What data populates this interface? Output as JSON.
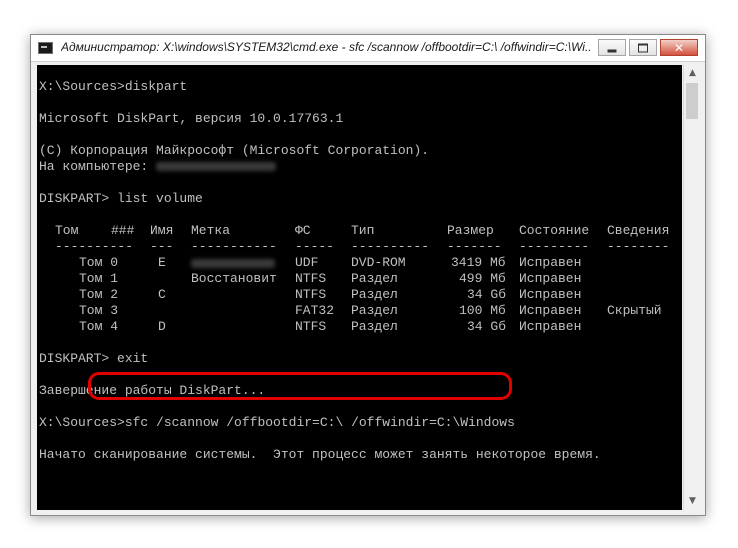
{
  "window": {
    "title": "Администратор: X:\\windows\\SYSTEM32\\cmd.exe - sfc  /scannow /offbootdir=C:\\ /offwindir=C:\\Wi..."
  },
  "console": {
    "lines": {
      "l1": "X:\\Sources>diskpart",
      "l2": "Microsoft DiskPart, версия 10.0.17763.1",
      "l3": "(C) Корпорация Майкрософт (Microsoft Corporation).",
      "l4": "На компьютере: ",
      "l5": "DISKPART> list volume",
      "l6": "DISKPART> exit",
      "l7": "Завершение работы DiskPart...",
      "l8_prompt": "X:\\Sources>",
      "l8_cmd": "sfc /scannow /offbootdir=C:\\ /offwindir=C:\\Windows",
      "l9": "Начато сканирование системы.  Этот процесс может занять некоторое время."
    },
    "table": {
      "headers": [
        "Том",
        "###",
        "Имя",
        "Метка",
        "ФС",
        "Тип",
        "Размер",
        "Состояние",
        "Сведения"
      ],
      "separators": [
        "----------",
        "---",
        "-----------",
        "-----",
        "----------",
        "-------",
        "---------",
        "--------"
      ],
      "rows": [
        {
          "num": "Том 0",
          "letter": "E",
          "label": "",
          "fs": "UDF",
          "type": "DVD-ROM",
          "size": "3419 Мб",
          "state": "Исправен",
          "info": ""
        },
        {
          "num": "Том 1",
          "letter": "",
          "label": "Восстановит",
          "fs": "NTFS",
          "type": "Раздел",
          "size": "499 Мб",
          "state": "Исправен",
          "info": ""
        },
        {
          "num": "Том 2",
          "letter": "C",
          "label": "",
          "fs": "NTFS",
          "type": "Раздел",
          "size": "34 Gб",
          "state": "Исправен",
          "info": ""
        },
        {
          "num": "Том 3",
          "letter": "",
          "label": "",
          "fs": "FAT32",
          "type": "Раздел",
          "size": "100 Мб",
          "state": "Исправен",
          "info": "Скрытый"
        },
        {
          "num": "Том 4",
          "letter": "D",
          "label": "",
          "fs": "NTFS",
          "type": "Раздел",
          "size": "34 Gб",
          "state": "Исправен",
          "info": ""
        }
      ]
    }
  },
  "colors": {
    "console_bg": "#000000",
    "console_text": "#c0c0c0",
    "highlight": "#e00000"
  }
}
